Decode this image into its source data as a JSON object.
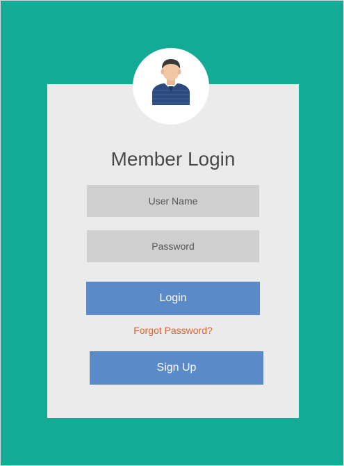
{
  "login_form": {
    "title": "Member Login",
    "username_placeholder": "User Name",
    "password_placeholder": "Password",
    "login_label": "Login",
    "forgot_label": "Forgot Password?",
    "signup_label": "Sign Up"
  },
  "avatar": {
    "icon": "user-avatar-icon"
  },
  "colors": {
    "background": "#14ab96",
    "card": "#ebebeb",
    "input": "#cfcfcf",
    "button": "#5a8ac8",
    "forgot_link": "#e3622e",
    "title_text": "#4a4a4a",
    "avatar_shirt": "#2c4a7d",
    "avatar_skin": "#f2c7a5",
    "avatar_hair": "#3a3a3a"
  }
}
